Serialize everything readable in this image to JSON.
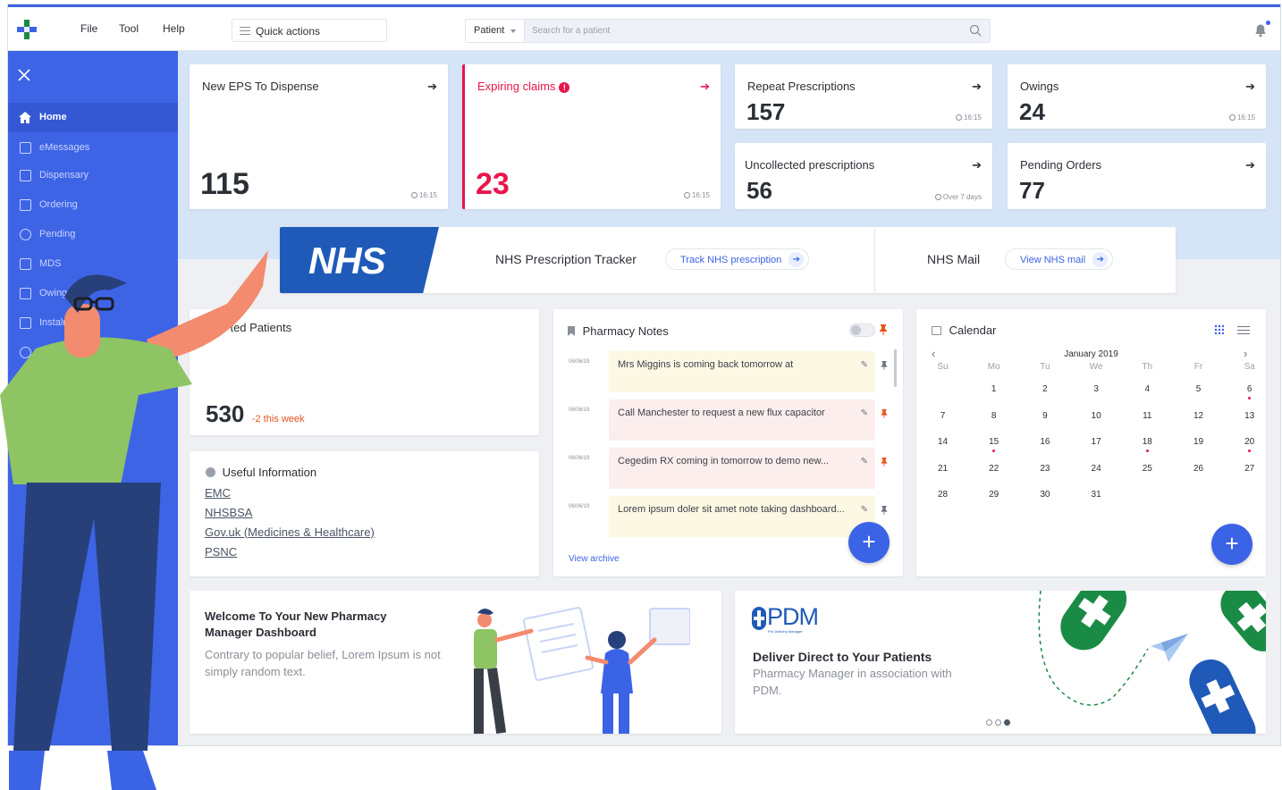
{
  "menu": {
    "file": "File",
    "tool": "Tool",
    "help": "Help"
  },
  "quick_actions": "Quick actions",
  "search": {
    "type": "Patient",
    "placeholder": "Search for a patient"
  },
  "sidebar": {
    "items": [
      {
        "label": "Home",
        "icon": "home-icon"
      },
      {
        "label": "eMessages",
        "icon": "message-icon"
      },
      {
        "label": "Dispensary",
        "icon": "document-icon"
      },
      {
        "label": "Ordering",
        "icon": "clipboard-icon"
      },
      {
        "label": "Pending",
        "icon": "stopwatch-icon"
      },
      {
        "label": "MDS",
        "icon": "grid-icon"
      },
      {
        "label": "Owings",
        "icon": "owings-icon"
      },
      {
        "label": "Instalments",
        "icon": "calendar-icon"
      },
      {
        "label": "Re",
        "icon": "refresh-icon"
      },
      {
        "label": "",
        "icon": "reports-icon"
      }
    ]
  },
  "cards": {
    "eps": {
      "title": "New EPS To Dispense",
      "value": "115",
      "time": "16:15"
    },
    "claims": {
      "title": "Expiring claims",
      "value": "23",
      "time": "16:15"
    },
    "repeat": {
      "title": "Repeat Prescriptions",
      "value": "157",
      "time": "16:15"
    },
    "owings": {
      "title": "Owings",
      "value": "24",
      "time": "16:15"
    },
    "uncollected": {
      "title": "Uncollected prescriptions",
      "value": "56",
      "time": "Over 7 days"
    },
    "pending": {
      "title": "Pending Orders",
      "value": "77"
    }
  },
  "nhs": {
    "logo": "NHS",
    "tracker_label": "NHS Prescription Tracker",
    "tracker_button": "Track NHS prescription",
    "mail_label": "NHS Mail",
    "mail_button": "View NHS mail"
  },
  "nominated": {
    "title": "Nominated Patients",
    "title_visible": "Non    ted Patients",
    "value": "530",
    "delta": "-2 this week"
  },
  "useful": {
    "title": "Useful Information",
    "links": [
      "EMC",
      "NHSBSA",
      "Gov.uk (Medicines & Healthcare)",
      "PSNC"
    ]
  },
  "notes": {
    "title": "Pharmacy Notes",
    "items": [
      {
        "date": "06/06/19",
        "text": "Mrs Miggins is coming back tomorrow at",
        "color": "yellow",
        "pinned": false
      },
      {
        "date": "06/06/19",
        "text": "Call Manchester to request a new flux capacitor",
        "color": "pink",
        "pinned": true
      },
      {
        "date": "06/06/19",
        "text": "Cegedim RX coming in tomorrow to demo new...",
        "color": "pink",
        "pinned": true
      },
      {
        "date": "06/06/19",
        "text": "Lorem ipsum doler sit amet note taking dashboard...",
        "color": "yellow",
        "pinned": false
      }
    ],
    "archive": "View archive"
  },
  "calendar": {
    "title": "Calendar",
    "month": "January 2019",
    "weekdays": [
      "Su",
      "Mo",
      "Tu",
      "We",
      "Th",
      "Fr",
      "Sa"
    ],
    "weeks": [
      [
        "",
        "1",
        "2",
        "3",
        "4",
        "5",
        "6"
      ],
      [
        "7",
        "8",
        "9",
        "10",
        "11",
        "12",
        "13"
      ],
      [
        "14",
        "15",
        "16",
        "17",
        "18",
        "19",
        "20"
      ],
      [
        "21",
        "22",
        "23",
        "24",
        "25",
        "26",
        "27"
      ],
      [
        "28",
        "29",
        "30",
        "31",
        "",
        "",
        ""
      ]
    ],
    "today": "3",
    "selected": "6",
    "event_days": [
      "6",
      "15",
      "18",
      "20"
    ]
  },
  "welcome": {
    "title": "Welcome To Your New Pharmacy Manager Dashboard",
    "body": "Contrary to popular belief, Lorem Ipsum is not simply random text."
  },
  "pdm": {
    "logo": "PDM",
    "logo_sub": "Pro Delivery Manager",
    "title": "Deliver Direct to Your Patients",
    "body": "Pharmacy Manager in association with PDM."
  },
  "colors": {
    "accent": "#3b63e6",
    "sidebar": "#3e64e6",
    "alert": "#e8164c",
    "band": "#d6e4f7",
    "nhs_blue": "#1f5ab8",
    "pdm_green": "#1a8b45"
  }
}
